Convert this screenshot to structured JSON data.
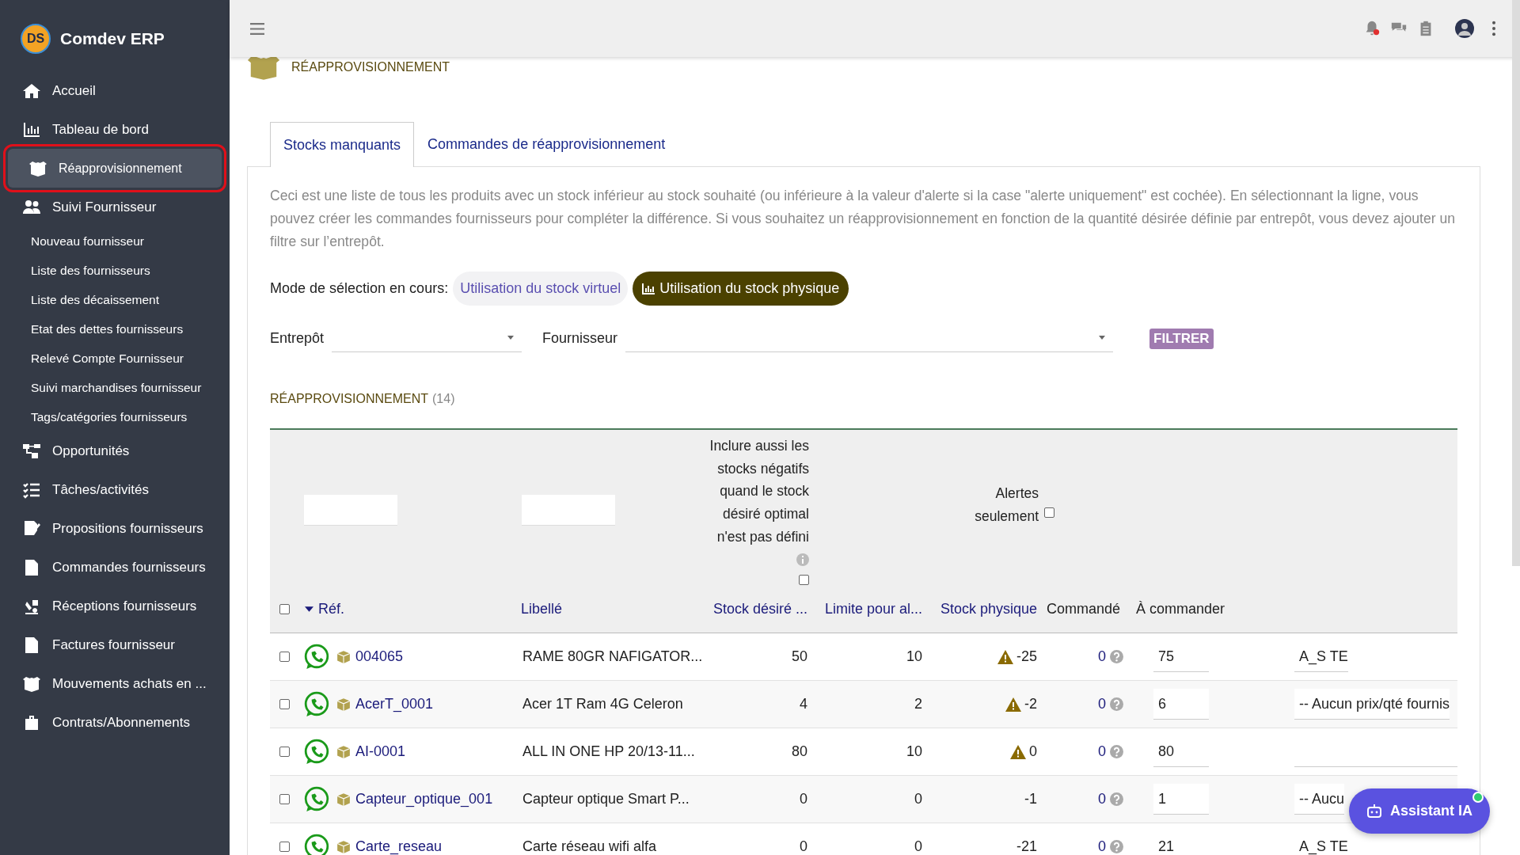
{
  "app": {
    "name": "Comdev ERP",
    "logo": "DS"
  },
  "sidebar": {
    "items": [
      {
        "label": "Accueil",
        "kind": "main",
        "selected": false
      },
      {
        "label": "Tableau de bord",
        "kind": "main",
        "selected": false
      },
      {
        "label": "Réapprovisionnement",
        "kind": "main",
        "selected": true
      },
      {
        "label": "Suivi Fournisseur",
        "kind": "main",
        "selected": false
      },
      {
        "label": "Nouveau fournisseur",
        "kind": "sub",
        "selected": false
      },
      {
        "label": "Liste des fournisseurs",
        "kind": "sub",
        "selected": false
      },
      {
        "label": "Liste des décaissement",
        "kind": "sub",
        "selected": false
      },
      {
        "label": "Etat des dettes fournisseurs",
        "kind": "sub",
        "selected": false
      },
      {
        "label": "Relevé Compte Fournisseur",
        "kind": "sub",
        "selected": false
      },
      {
        "label": "Suivi marchandises fournisseur",
        "kind": "sub",
        "selected": false
      },
      {
        "label": "Tags/catégories fournisseurs",
        "kind": "sub",
        "selected": false
      },
      {
        "label": "Opportunités",
        "kind": "main",
        "selected": false
      },
      {
        "label": "Tâches/activités",
        "kind": "main",
        "selected": false
      },
      {
        "label": "Propositions fournisseurs",
        "kind": "main",
        "selected": false
      },
      {
        "label": "Commandes fournisseurs",
        "kind": "main",
        "selected": false
      },
      {
        "label": "Réceptions fournisseurs",
        "kind": "main",
        "selected": false
      },
      {
        "label": "Factures fournisseur",
        "kind": "main",
        "selected": false
      },
      {
        "label": "Mouvements achats en ...",
        "kind": "main",
        "selected": false
      },
      {
        "label": "Contrats/Abonnements",
        "kind": "main",
        "selected": false
      }
    ]
  },
  "page_title": "RÉAPPROVISIONNEMENT",
  "tabs": [
    {
      "label": "Stocks manquants",
      "selected": true
    },
    {
      "label": "Commandes de réapprovisionnement",
      "selected": false
    }
  ],
  "description": "Ceci est une liste de tous les produits avec un stock inférieur au stock souhaité (ou inférieure à la valeur d'alerte si la case \"alerte uniquement\" est cochée). En sélectionnant la ligne, vous pouvez créer les commandes fournisseurs pour compléter la différence. Si vous souhaitez un réapprovisionnement en fonction de la quantité désirée définie par entrepôt, vous devez ajouter un filtre sur l’entrepôt.",
  "mode": {
    "label": "Mode de sélection en cours:",
    "options": [
      {
        "label": "Utilisation du stock virtuel",
        "selected": false
      },
      {
        "label": "Utilisation du stock physique",
        "selected": true
      }
    ]
  },
  "filters": {
    "warehouse_label": "Entrepôt",
    "supplier_label": "Fournisseur",
    "button": "FILTRER"
  },
  "section": {
    "title": "RÉAPPROVISIONNEMENT",
    "count": "(14)"
  },
  "table": {
    "include_negative": {
      "label": "Inclure aussi les stocks négatifs quand le stock désiré optimal n'est pas défini",
      "checked": false
    },
    "alerts_only": {
      "label": "Alertes seulement",
      "checked": false
    },
    "select_all": {
      "checked": false
    },
    "columns": [
      {
        "label": "Réf.",
        "sortable": true
      },
      {
        "label": "Libellé",
        "sortable": true
      },
      {
        "label": "Stock désiré ...",
        "sortable": true
      },
      {
        "label": "Limite pour al...",
        "sortable": true
      },
      {
        "label": "Stock physique",
        "sortable": true
      },
      {
        "label": "Commandé",
        "sortable": false
      },
      {
        "label": "À commander",
        "sortable": false
      }
    ],
    "rows": [
      {
        "checked": false,
        "ref": "004065",
        "label": "RAME 80GR NAFIGATOR...",
        "desired": "50",
        "limit": "10",
        "physical": "-25",
        "warning": true,
        "ordered": "0",
        "to_order": "75",
        "supplier": "A_S TE"
      },
      {
        "checked": false,
        "ref": "AcerT_0001",
        "label": "Acer 1T Ram 4G Celeron",
        "desired": "4",
        "limit": "2",
        "physical": "-2",
        "warning": true,
        "ordered": "0",
        "to_order": "6",
        "supplier": "-- Aucun prix/qté fournis"
      },
      {
        "checked": false,
        "ref": "AI-0001",
        "label": "ALL IN ONE HP 20/13-11...",
        "desired": "80",
        "limit": "10",
        "physical": "0",
        "warning": true,
        "ordered": "0",
        "to_order": "80"
      },
      {
        "checked": false,
        "ref": "Capteur_optique_001",
        "label": "Capteur optique Smart P...",
        "desired": "0",
        "limit": "0",
        "physical": "-1",
        "warning": false,
        "ordered": "0",
        "to_order": "1",
        "supplier": "-- Aucu"
      },
      {
        "checked": false,
        "ref": "Carte_reseau",
        "label": "Carte réseau wifi alfa",
        "desired": "0",
        "limit": "0",
        "physical": "-21",
        "warning": false,
        "ordered": "0",
        "to_order": "21",
        "supplier": "A_S TE"
      }
    ]
  },
  "assistant": {
    "label": "Assistant IA",
    "online": true
  }
}
